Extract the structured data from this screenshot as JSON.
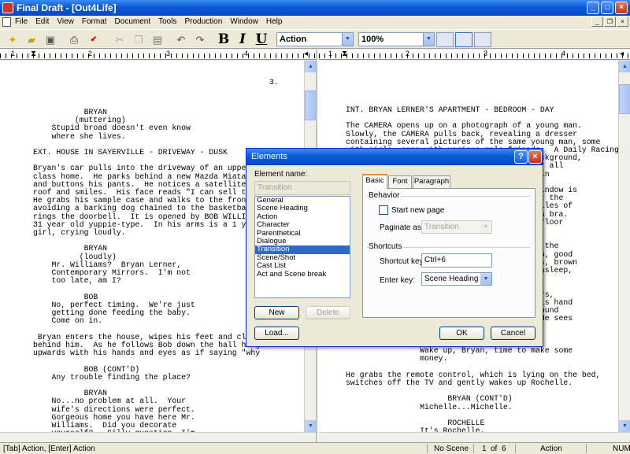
{
  "window": {
    "title": "Final Draft - [Out4Life]"
  },
  "menu": [
    "File",
    "Edit",
    "View",
    "Format",
    "Document",
    "Tools",
    "Production",
    "Window",
    "Help"
  ],
  "toolbar": {
    "bold_label": "B",
    "italic_label": "I",
    "underline_label": "U",
    "element_combo": "Action",
    "zoom_combo": "100%"
  },
  "left_pane": {
    "page_number": "3.",
    "script_text": "           BRYAN\n         (muttering)\n    Stupid broad doesn't even know\n    where she lives.\n\nEXT. HOUSE IN SAYERVILLE - DRIVEWAY - DUSK\n\nBryan's car pulls into the driveway of an upper-m\nclass home.  He parks behind a new Mazda Miata, g\nand buttons his pants.  He notices a satellite di\nroof and smiles.  His face reads \"I can sell these\nHe grabs his sample case and walks to the front do\navoiding a barking dog chained to the basketball h\nrings the doorbell.  It is opened by BOB WILLIAMS\n31 year old yuppie-type.  In his arms is a 1 year\ngirl, crying loudly.\n\n           BRYAN\n          (loudly)\n    Mr. Williams?  Bryan Lerner,\n    Contemporary Mirrors.  I'm not\n    too late, am I?\n\n           BOB\n    No, perfect timing.  We're just\n    getting done feeding the baby.\n    Come on in.\n\n Bryan enters the house, wipes his feet and closes\nbehind him.  As he follows Bob down the hall he ge\nupwards with his hands and eyes as if saying \"why\n\n           BOB (CONT'D)\n    Any trouble finding the place?\n\n           BRYAN\n    No...no problem at all.  Your\n    wife's directions were perfect.\n    Gorgeous home you have here Mr.\n    Williams.  Did you decorate\n    yourself?...Silly question, I'm\n    sure you did...wonderful taste.\n\nINT. HOUSE IN SAYERVILLE - KITCHEN - DUSK"
  },
  "right_pane": {
    "script_text": "INT. BRYAN LERNER'S APARTMENT - BEDROOM - DAY\n\nThe CAMERA opens up on a photograph of a young man.\nSlowly, the CAMERA pulls back, revealing a dresser\ncontaining several pictures of the same young man, some\nwith girls, some with various male friends.  A Daily Racing\n                                      e background,\n                                     .  For all\n                                     here in\n\n                                     the window is\n                                     ck out the\n                                     ral piles of\n                                      and a bra.\n                                      the floor\n                                     of\n\n                                     p, is the\n                                     ER, 26, good\n                                     n eyes, brown\n                                     also asleep,\n                                     hteen.\n\n                                     y stirs,\n                                     M.  His hand\n                                     The sound\n                                     ck.  He sees\n\n\n\n                Wake up, Bryan, time to make some\n                money.\n\nHe grabs the remote control, which is lying on the bed,\nswitches off the TV and gently wakes up Rochelle.\n\n                      BRYAN (CONT'D)\n                Michelle...Michelle.\n\n                      ROCHELLE\n                It's Rochelle."
  },
  "dialog": {
    "title": "Elements",
    "help_button": "?",
    "element_name_label": "Element name:",
    "element_name_value": "Transition",
    "elements": [
      "General",
      "Scene Heading",
      "Action",
      "Character",
      "Parenthetical",
      "Dialogue",
      "Transition",
      "Scene/Shot",
      "Cast List",
      "Act and Scene break"
    ],
    "selected_element": "Transition",
    "new_button": "New",
    "delete_button": "Delete",
    "load_button": "Load...",
    "tabs": [
      "Basic",
      "Font",
      "Paragraph"
    ],
    "active_tab": "Basic",
    "behavior_group": "Behavior",
    "start_new_page_label": "Start new page",
    "paginate_as_label": "Paginate as:",
    "paginate_as_value": "Transition",
    "shortcuts_group": "Shortcuts",
    "shortcut_key_label": "Shortcut key:",
    "shortcut_key_value": "Ctrl+6",
    "enter_key_label": "Enter key:",
    "enter_key_value": "Scene Heading",
    "ok_button": "OK",
    "cancel_button": "Cancel"
  },
  "status": {
    "hint": "[Tab] Action, [Enter] Action",
    "scene": "No Scene",
    "page_current": "1",
    "page_of": "of",
    "page_total": "6",
    "element": "Action",
    "num": "NUM"
  }
}
